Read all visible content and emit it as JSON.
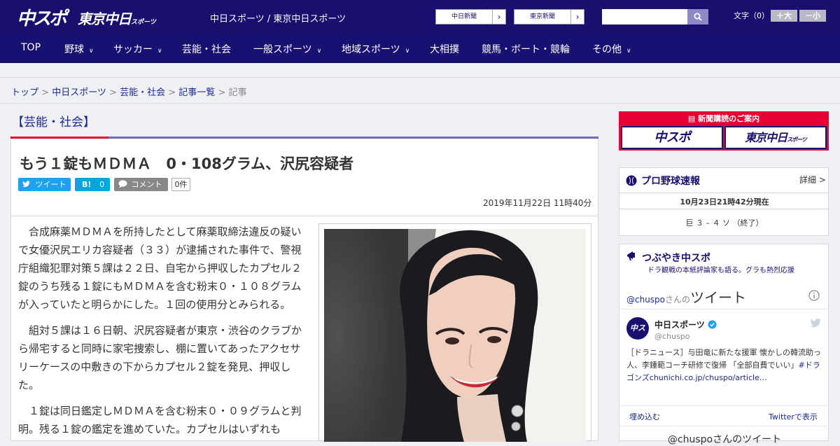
{
  "header": {
    "logo_chuspo": "中スポ",
    "logo_tokyo": "東京中日",
    "logo_tokyo_sub": "スポーツ",
    "site_name": "中日スポーツ / 東京中日スポーツ",
    "paper1": "中日新聞",
    "paper2": "東京新聞",
    "search_placeholder": "",
    "font_label": "文字（0）",
    "font_big": "＋大",
    "font_small": "－小"
  },
  "nav": [
    {
      "label": "TOP",
      "chevron": ""
    },
    {
      "label": "野球",
      "chevron": "∨"
    },
    {
      "label": "サッカー",
      "chevron": "∨"
    },
    {
      "label": "芸能・社会",
      "chevron": ""
    },
    {
      "label": "一般スポーツ",
      "chevron": "∨"
    },
    {
      "label": "地域スポーツ",
      "chevron": "∨"
    },
    {
      "label": "大相撲",
      "chevron": ""
    },
    {
      "label": "競馬・ボート・競輪",
      "chevron": ""
    },
    {
      "label": "その他",
      "chevron": "∨"
    }
  ],
  "breadcrumb": {
    "items": [
      "トップ",
      "中日スポーツ",
      "芸能・社会",
      "記事一覧"
    ],
    "current": "記事",
    "sep": " > "
  },
  "article": {
    "category": "【芸能・社会】",
    "title": "もう１錠もＭＤＭＡ　0・108グラム、沢尻容疑者",
    "tweet": "ツイート",
    "hatena": "B!",
    "hatena_count": "0",
    "comment": "コメント",
    "comment_count": "0件",
    "date": "2019年11月22日 11時40分",
    "paragraphs": [
      "合成麻薬ＭＤＭＡを所持したとして麻薬取締法違反の疑いで女優沢尻エリカ容疑者（３３）が逮捕された事件で、警視庁組織犯罪対策５課は２２日、自宅から押収したカプセル２錠のうち残る１錠にもＭＤＭＡを含む粉末０・１０８グラムが入っていたと明らかにした。１回の使用分とみられる。",
      "組対５課は１６日朝、沢尻容疑者が東京・渋谷のクラブから帰宅すると同時に家宅捜索し、棚に置いてあったアクセサリーケースの中敷きの下からカプセル２錠を発見、押収した。",
      "１錠は同日鑑定しＭＤＭＡを含む粉末０・０９グラムと判明。残る１錠の鑑定を進めていた。カプセルはいずれも"
    ]
  },
  "sidebar": {
    "subscribe_title": "新聞購読のご案内",
    "subscribe_chuspo": "中スポ",
    "subscribe_tokyo": "東京中日",
    "subscribe_tokyo_sub": "スポーツ",
    "baseball": {
      "title": "プロ野球速報",
      "more": "詳細 >",
      "time": "10月23日21時42分現在",
      "score": "巨 ３ – ４ ソ （終了）"
    },
    "tsubuyaki": {
      "title": "つぶやき中スポ",
      "subtitle": "ドラ観戦の本紙評論家も語る。グラも熱烈応援"
    },
    "twitter": {
      "account": "@chuspo",
      "san": "さんの",
      "tweet_word": "ツイート",
      "user_name": "中日スポーツ",
      "user_handle": "@chuspo",
      "tweet_text": "［ドラニュース］与田竜に新たな援軍 懐かしの韓流助っ人、李鍾範コーチ研修で復帰 「全部自費でい",
      "tweet_tail": "い」",
      "tweet_link": "#ドラゴンズchunichi.co.jp/chuspo/article…",
      "embed": "埋め込む",
      "view": "Twitterで表示",
      "footer": "@chuspoさんのツイート"
    }
  },
  "colors": {
    "header_bg": "#180f6f",
    "nav_bg": "#191172",
    "accent_red": "#e60033",
    "link": "#1d2b8f",
    "twitter": "#1da1f2",
    "hatena": "#00a4de"
  }
}
